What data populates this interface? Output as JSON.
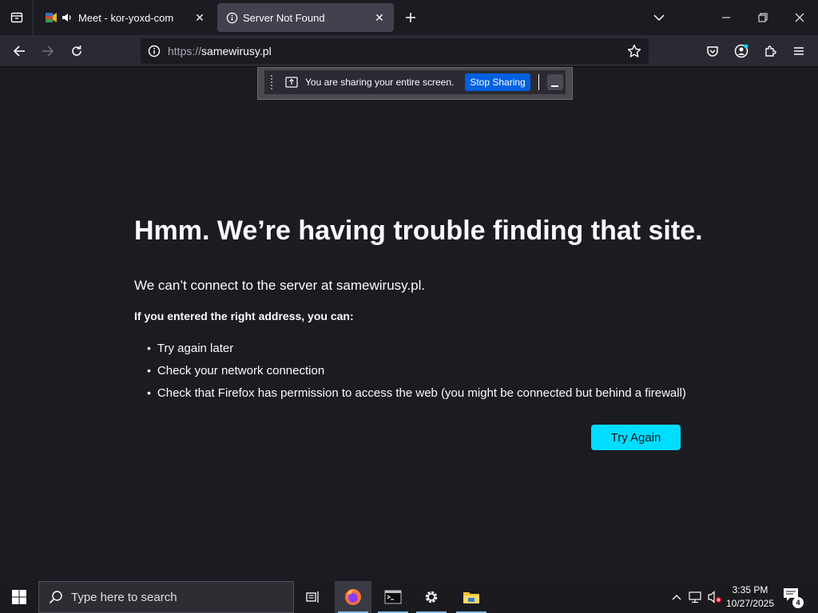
{
  "tabs": [
    {
      "title": "Meet - kor-yoxd-com",
      "audio": true,
      "active": false
    },
    {
      "title": "Server Not Found",
      "active": true
    }
  ],
  "toolbar": {
    "url_scheme": "https://",
    "url_host": "samewirusy.pl"
  },
  "sharing": {
    "message": "You are sharing your entire screen.",
    "stop_label": "Stop Sharing"
  },
  "error": {
    "title": "Hmm. We’re having trouble finding that site.",
    "description": "We can’t connect to the server at samewirusy.pl.",
    "subtitle": "If you entered the right address, you can:",
    "suggestions": [
      "Try again later",
      "Check your network connection",
      "Check that Firefox has permission to access the web (you might be connected but behind a firewall)"
    ],
    "try_again_label": "Try Again"
  },
  "taskbar": {
    "search_placeholder": "Type here to search",
    "time": "3:35 PM",
    "date": "10/27/2025",
    "notification_count": "4"
  },
  "colors": {
    "accent_button": "#00ddff",
    "stop_sharing": "#0060df",
    "page_bg": "#1c1b22"
  }
}
